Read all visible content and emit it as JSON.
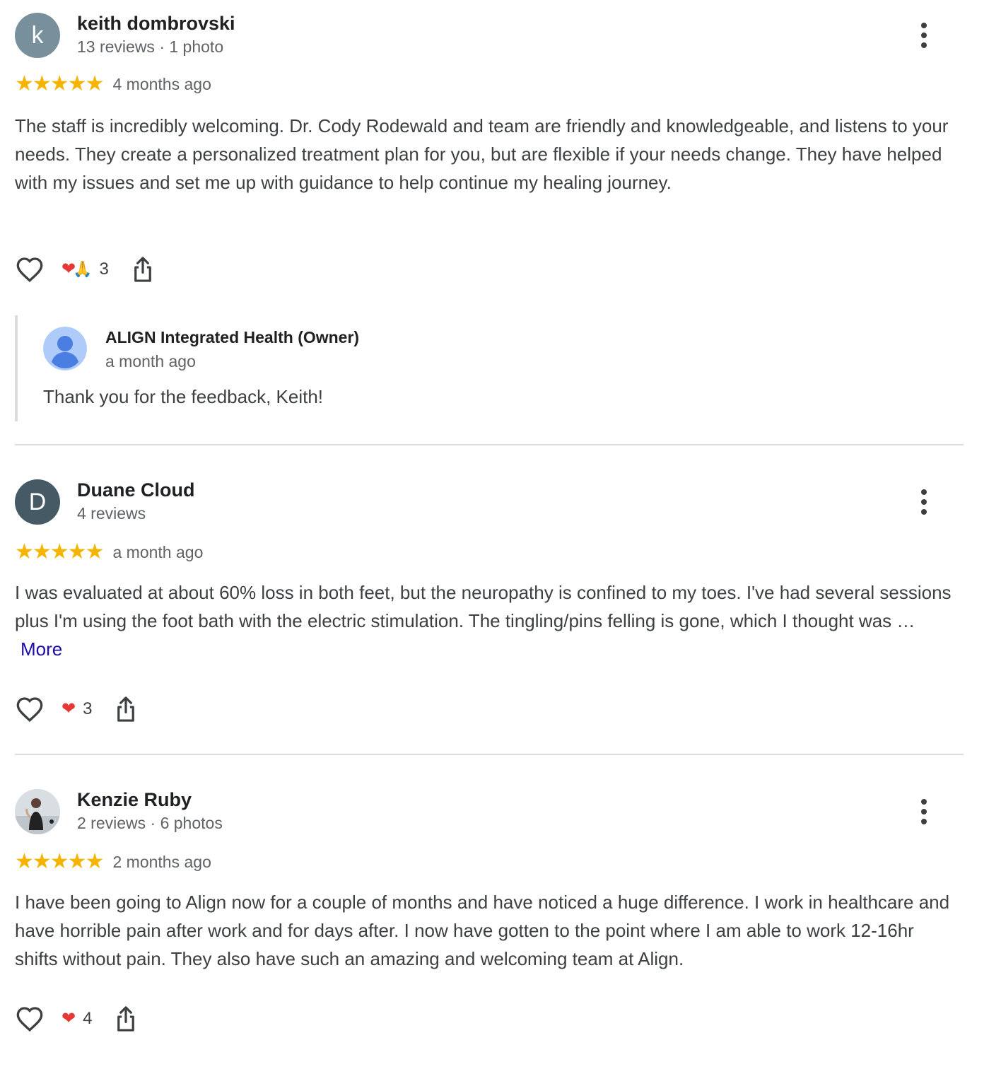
{
  "reviews": [
    {
      "avatar_letter": "k",
      "avatar_color": "#78909c",
      "author": "keith dombrovski",
      "meta": "13 reviews · 1 photo",
      "stars": "★★★★★",
      "rating": 5,
      "date": "4 months ago",
      "text": "The staff is incredibly welcoming. Dr. Cody Rodewald and team are friendly and knowledgeable, and listens to your needs. They create a personalized treatment plan for you, but are flexible if your needs change. They have helped with my issues and set me up with guidance to help continue my healing journey.",
      "reactions": {
        "heart": "❤",
        "pray": "🙏",
        "count": "3"
      },
      "owner_reply": {
        "name": "ALIGN Integrated Health (Owner)",
        "date": "a month ago",
        "text": "Thank you for the feedback, Keith!"
      }
    },
    {
      "avatar_letter": "D",
      "avatar_color": "#455a64",
      "author": "Duane Cloud",
      "meta": "4 reviews",
      "stars": "★★★★★",
      "rating": 5,
      "date": "a month ago",
      "text": "I was evaluated at about 60% loss in both feet, but the neuropathy is confined to my toes. I've had several sessions plus I'm using the foot bath with the electric stimulation. The tingling/pins felling is gone, which I thought was …",
      "more": "More",
      "reactions": {
        "heart": "❤",
        "count": "3"
      }
    },
    {
      "avatar_letter": "",
      "avatar_color": "#d7dcdf",
      "author": "Kenzie Ruby",
      "meta": "2 reviews · 6 photos",
      "stars": "★★★★★",
      "rating": 5,
      "date": "2 months ago",
      "text": "I have been going to Align now for a couple of months and have noticed a huge difference. I work in healthcare and have horrible pain after work and for days after. I now have gotten to the point where I am able to work 12-16hr shifts without pain. They also have such an amazing and welcoming team at Align.",
      "reactions": {
        "heart": "❤",
        "count": "4"
      }
    }
  ]
}
